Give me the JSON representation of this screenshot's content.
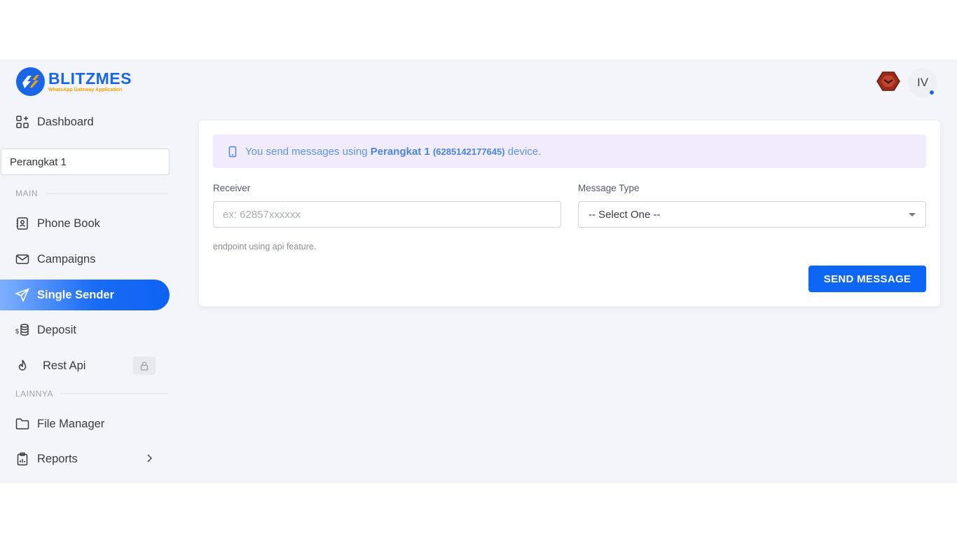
{
  "brand": {
    "name": "BLITZMES",
    "tagline": "WhatsApp Gateway Application",
    "primary_color": "#1a66e8",
    "accent_color": "#f4a100"
  },
  "header": {
    "avatar_initials": "IV",
    "status_dot_color": "#1a66e8"
  },
  "sidebar": {
    "dashboard": {
      "label": "Dashboard",
      "icon": "dashboard-grid-icon"
    },
    "device_select": {
      "value": "Perangkat 1"
    },
    "section_main": "MAIN",
    "items_main": [
      {
        "label": "Phone Book",
        "icon": "contact-book-icon"
      },
      {
        "label": "Campaigns",
        "icon": "envelope-icon"
      },
      {
        "label": "Single Sender",
        "icon": "paper-plane-icon",
        "active": true
      },
      {
        "label": "Deposit",
        "icon": "coins-icon"
      },
      {
        "label": "Rest Api",
        "icon": "flame-icon",
        "locked": true
      }
    ],
    "section_other": "LAINNYA",
    "items_other": [
      {
        "label": "File Manager",
        "icon": "folder-icon"
      },
      {
        "label": "Reports",
        "icon": "clipboard-icon",
        "has_submenu": true
      }
    ]
  },
  "form": {
    "alert": {
      "prefix": "You send messages using",
      "device_name": "Perangkat 1",
      "device_number": "(6285142177645)",
      "suffix": "device."
    },
    "receiver": {
      "label": "Receiver",
      "placeholder": "ex: 62857xxxxxx"
    },
    "message_type": {
      "label": "Message Type",
      "selected": "-- Select One --"
    },
    "hint": "endpoint using api feature.",
    "submit_label": "SEND MESSAGE"
  }
}
